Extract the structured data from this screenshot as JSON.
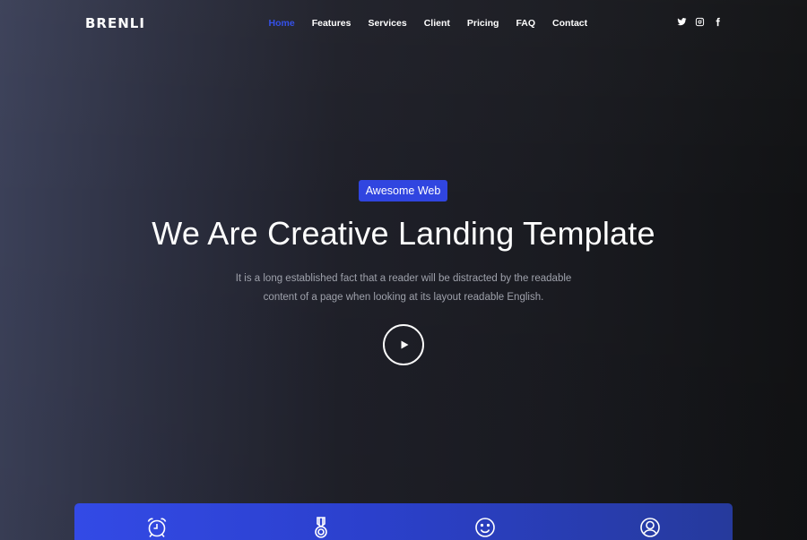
{
  "brand": "BRENLI",
  "nav": {
    "items": [
      {
        "label": "Home",
        "active": true
      },
      {
        "label": "Features",
        "active": false
      },
      {
        "label": "Services",
        "active": false
      },
      {
        "label": "Client",
        "active": false
      },
      {
        "label": "Pricing",
        "active": false
      },
      {
        "label": "FAQ",
        "active": false
      },
      {
        "label": "Contact",
        "active": false
      }
    ]
  },
  "social": [
    "twitter-icon",
    "instagram-icon",
    "facebook-icon"
  ],
  "hero": {
    "badge": "Awesome Web",
    "title": "We Are Creative Landing Template",
    "subtitle": "It is a long established fact that a reader will be distracted by the readable content of a page when looking at its layout readable English.",
    "play_icon": "play-icon"
  },
  "features": {
    "icons": [
      "alarm-clock-icon",
      "medal-icon",
      "smiley-icon",
      "user-icon"
    ]
  },
  "colors": {
    "accent": "#3045e0",
    "active_nav": "#3551ea",
    "text_muted": "#a0a3ad",
    "strip_start": "#334ae6",
    "strip_end": "#263a9c"
  }
}
